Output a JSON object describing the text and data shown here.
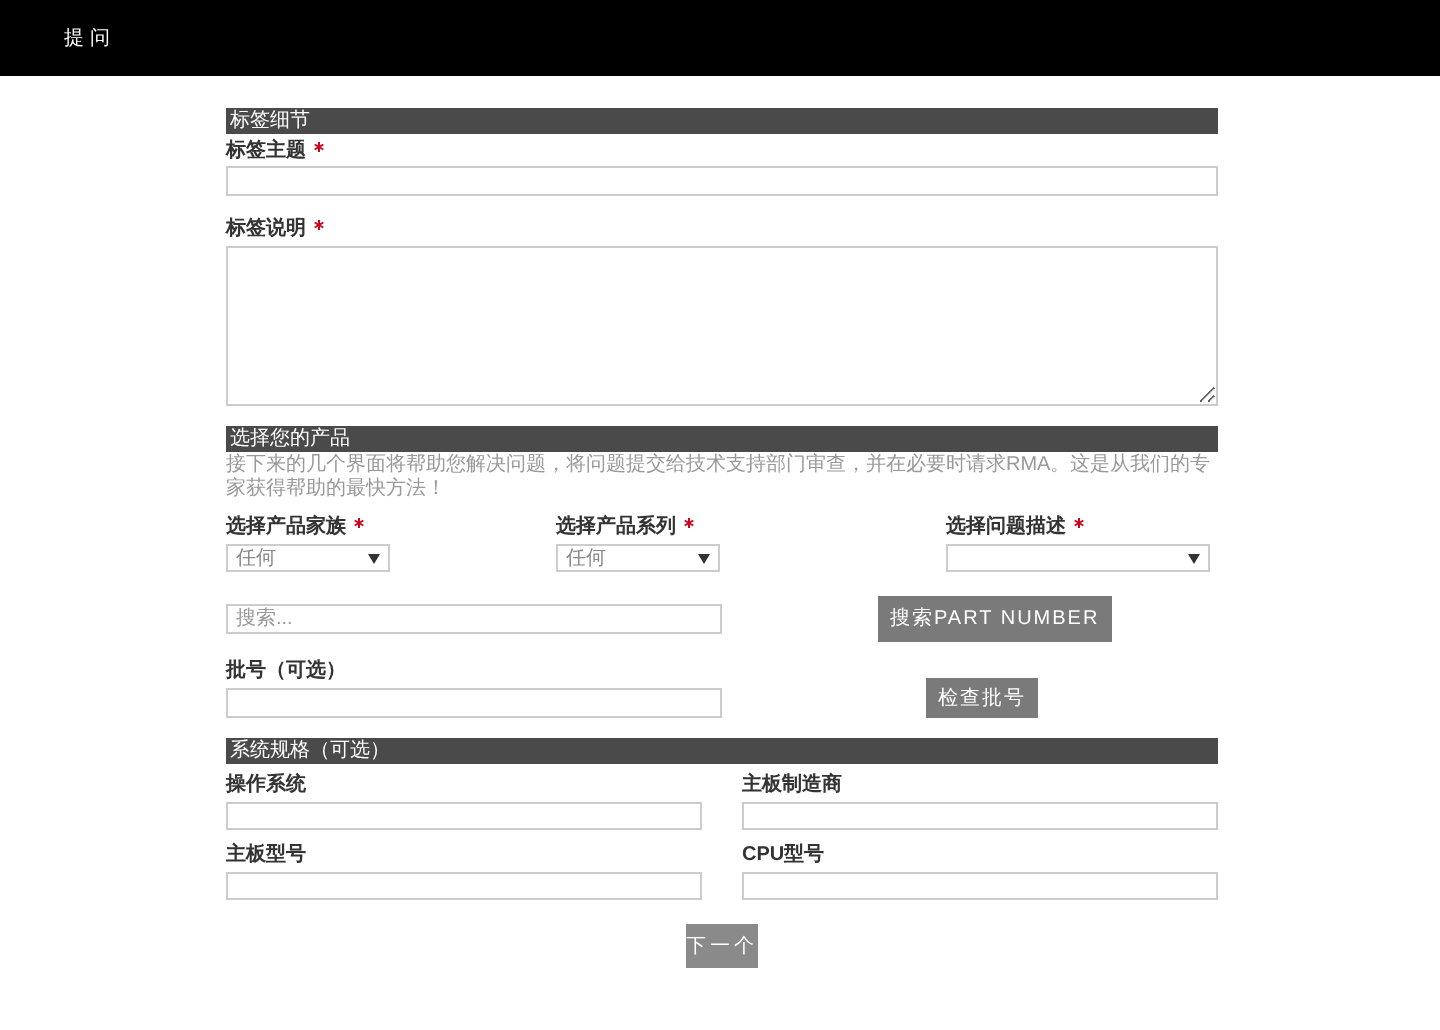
{
  "header": {
    "title": "提 问"
  },
  "ticket_details": {
    "heading": "标签细节",
    "subject": {
      "label": "标签主题",
      "required": true
    },
    "description": {
      "label": "标签说明",
      "required": true
    }
  },
  "product": {
    "heading": "选择您的产品",
    "intro": "接下来的几个界面将帮助您解决问题，将问题提交给技术支持部门审查，并在必要时请求RMA。这是从我们的专家获得帮助的最快方法！",
    "selects": [
      {
        "label": "选择产品家族",
        "required": true,
        "value": "任何"
      },
      {
        "label": "选择产品系列",
        "required": true,
        "value": "任何"
      },
      {
        "label": "选择问题描述",
        "required": true
      }
    ],
    "search": {
      "placeholder": "搜索...",
      "button": "搜索PART NUMBER"
    },
    "batch": {
      "label": "批号（可选）",
      "button": "检查批号"
    }
  },
  "system": {
    "heading": "系统规格（可选）",
    "fields": [
      {
        "label": "操作系统"
      },
      {
        "label": "主板制造商"
      },
      {
        "label": "主板型号"
      },
      {
        "label": "CPU型号"
      }
    ]
  },
  "next_button": "下一个"
}
